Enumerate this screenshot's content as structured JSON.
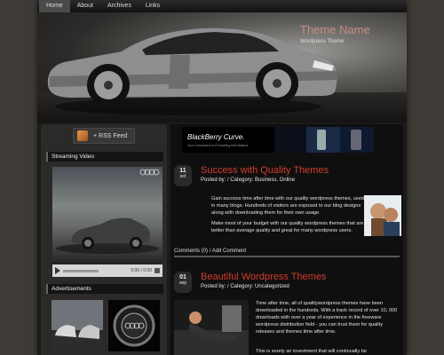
{
  "nav": {
    "items": [
      "Home",
      "About",
      "Archives",
      "Links"
    ]
  },
  "header": {
    "title": "Theme Name",
    "description": "Wordpress Theme"
  },
  "sidebar": {
    "rss_label": "+ RSS Feed",
    "video_heading": "Streaming Video",
    "video_time": "0:00 / 0:00",
    "ads_heading": "Advertisements"
  },
  "banner": {
    "logo": "BlackBerry Curve.",
    "tagline": "Your Connection to Everything that Matters."
  },
  "posts": [
    {
      "day": "11",
      "month": "oct",
      "title": "Success with Quality Themes",
      "meta": "Posted by:  /  Category: Business, Online",
      "para1": "Gain success time after time with our quality wordpress themes, used in many blogs. Hundreds of visitors are exposed to our blog designs along with downloading them for their own usage.",
      "para2": "Make most of your budget with our quality wordpress themes that are better than average quality and great for many wordpress users.",
      "comments": "Comments (0)",
      "add_comment": "Add Comment"
    },
    {
      "day": "01",
      "month": "sep",
      "title": "Beautiful Wordpress Themes",
      "meta": "Posted by:  /  Category: Uncategorized",
      "para1": "Time after time, all of qualitywordpress themes have been downloaded in the hundreds. With a track record of over 10, 000 downloads with over a year of experience in the freeware wordpress distribution field - you can trust them for quality releases and themes time after time.",
      "para2": "This is surely an investment that will continually be"
    }
  ],
  "colors": {
    "accent_red": "#d33b2c",
    "title_pink": "#c88c84"
  }
}
